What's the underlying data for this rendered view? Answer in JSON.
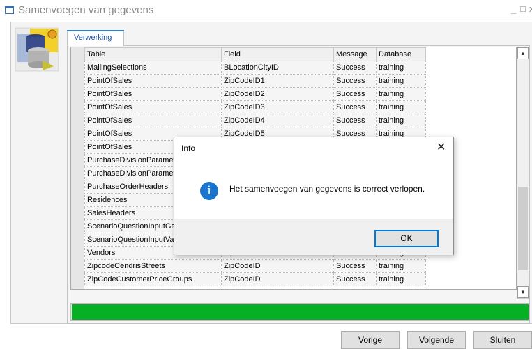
{
  "window": {
    "title": "Samenvoegen van gegevens",
    "minimize_glyph": "_",
    "maximize_glyph": "□",
    "close_glyph": "x"
  },
  "tabs": [
    {
      "label": "Verwerking"
    }
  ],
  "grid": {
    "columns": [
      "Table",
      "Field",
      "Message",
      "Database"
    ],
    "rows": [
      [
        "MailingSelections",
        "BLocationCityID",
        "Success",
        "training"
      ],
      [
        "PointOfSales",
        "ZipCodeID1",
        "Success",
        "training"
      ],
      [
        "PointOfSales",
        "ZipCodeID2",
        "Success",
        "training"
      ],
      [
        "PointOfSales",
        "ZipCodeID3",
        "Success",
        "training"
      ],
      [
        "PointOfSales",
        "ZipCodeID4",
        "Success",
        "training"
      ],
      [
        "PointOfSales",
        "ZipCodeID5",
        "Success",
        "training"
      ],
      [
        "PointOfSales",
        "",
        "",
        ""
      ],
      [
        "PurchaseDivisionParamet",
        "",
        "",
        ""
      ],
      [
        "PurchaseDivisionParamet",
        "",
        "",
        ""
      ],
      [
        "PurchaseOrderHeaders",
        "",
        "",
        ""
      ],
      [
        "Residences",
        "",
        "",
        ""
      ],
      [
        "SalesHeaders",
        "",
        "",
        ""
      ],
      [
        "ScenarioQuestionInputGe",
        "",
        "",
        ""
      ],
      [
        "ScenarioQuestionInputVa",
        "",
        "",
        ""
      ],
      [
        "Vendors",
        "ZipCodeID",
        "Success",
        "training"
      ],
      [
        "ZipcodeCendrisStreets",
        "ZipCodeID",
        "Success",
        "training"
      ],
      [
        "ZipCodeCustomerPriceGroups",
        "ZipCodeID",
        "Success",
        "training"
      ]
    ]
  },
  "progress": {
    "value_percent": 100,
    "color": "#06b025"
  },
  "buttons": {
    "previous": "Vorige",
    "next": "Volgende",
    "close": "Sluiten"
  },
  "dialog": {
    "title": "Info",
    "close_glyph": "✕",
    "icon": "info-icon",
    "icon_glyph": "i",
    "message": "Het samenvoegen van gegevens is correct verlopen.",
    "ok_label": "OK"
  },
  "scrollbar": {
    "up_glyph": "▲",
    "down_glyph": "▼"
  }
}
